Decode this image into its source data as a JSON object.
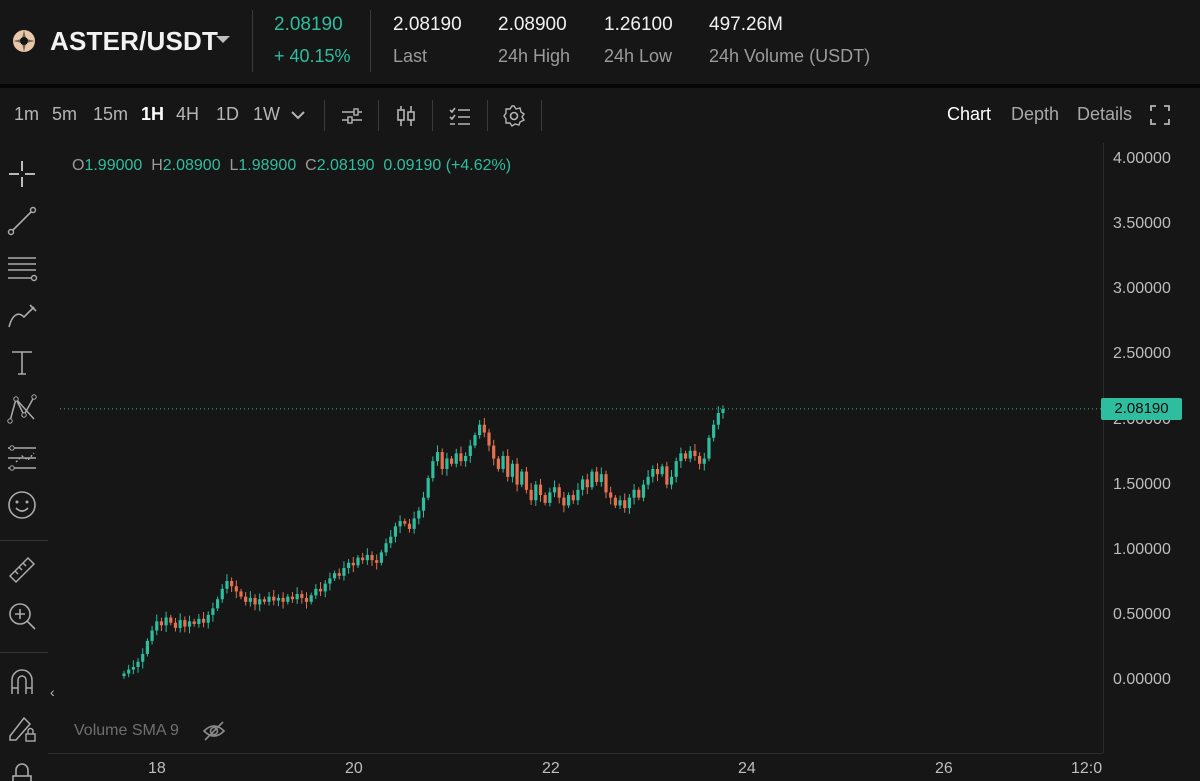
{
  "header": {
    "pair": "ASTER/USDT",
    "last_price": "2.08190",
    "change_pct": "+ 40.15%",
    "stats": [
      {
        "value": "2.08190",
        "label": "Last"
      },
      {
        "value": "2.08900",
        "label": "24h High"
      },
      {
        "value": "1.26100",
        "label": "24h Low"
      },
      {
        "value": "497.26M",
        "label": "24h Volume (USDT)"
      }
    ]
  },
  "toolbar": {
    "timeframes": [
      "1m",
      "5m",
      "15m",
      "1H",
      "4H",
      "1D",
      "1W"
    ],
    "active_timeframe": "1H",
    "views": [
      "Chart",
      "Depth",
      "Details"
    ],
    "active_view": "Chart"
  },
  "left_tools": [
    "crosshair-icon",
    "trendline-icon",
    "horizontal-lines-icon",
    "brush-icon",
    "text-icon",
    "pattern-icon",
    "forecast-icon",
    "emoji-icon",
    "ruler-icon",
    "zoom-in-icon",
    "magnet-icon",
    "lock-draw-icon",
    "lock-icon"
  ],
  "ohlc": {
    "o_label": "O",
    "o": "1.99000",
    "h_label": "H",
    "h": "2.08900",
    "l_label": "L",
    "l": "1.98900",
    "c_label": "C",
    "c": "2.08190",
    "change": "0.09190",
    "change_pct": "(+4.62%)"
  },
  "price_tag": "2.08190",
  "volume_label": "Volume SMA 9",
  "colors": {
    "up": "#2ebd9f",
    "down": "#e5714f",
    "bg": "#161616"
  },
  "chart_data": {
    "type": "candlestick",
    "y_ticks": [
      "4.00000",
      "3.50000",
      "3.00000",
      "2.50000",
      "2.00000",
      "1.50000",
      "1.00000",
      "0.50000",
      "0.00000"
    ],
    "ylim": [
      0,
      4.0
    ],
    "x_ticks": [
      "18",
      "20",
      "22",
      "24",
      "26",
      "12:0"
    ],
    "last_price": 2.0819,
    "close_series": [
      0.05,
      0.08,
      0.1,
      0.14,
      0.2,
      0.3,
      0.38,
      0.45,
      0.42,
      0.48,
      0.44,
      0.4,
      0.46,
      0.41,
      0.45,
      0.43,
      0.47,
      0.44,
      0.5,
      0.55,
      0.62,
      0.7,
      0.76,
      0.72,
      0.68,
      0.64,
      0.6,
      0.63,
      0.58,
      0.62,
      0.6,
      0.64,
      0.61,
      0.63,
      0.6,
      0.64,
      0.62,
      0.66,
      0.63,
      0.6,
      0.65,
      0.7,
      0.68,
      0.74,
      0.78,
      0.82,
      0.8,
      0.86,
      0.9,
      0.88,
      0.94,
      0.92,
      0.96,
      0.92,
      0.9,
      0.98,
      1.05,
      1.1,
      1.18,
      1.22,
      1.2,
      1.16,
      1.24,
      1.3,
      1.4,
      1.55,
      1.68,
      1.75,
      1.62,
      1.7,
      1.66,
      1.74,
      1.68,
      1.72,
      1.8,
      1.88,
      1.96,
      1.9,
      1.8,
      1.7,
      1.62,
      1.72,
      1.56,
      1.66,
      1.5,
      1.6,
      1.46,
      1.38,
      1.5,
      1.42,
      1.36,
      1.44,
      1.48,
      1.4,
      1.34,
      1.42,
      1.38,
      1.46,
      1.54,
      1.48,
      1.6,
      1.52,
      1.58,
      1.44,
      1.4,
      1.34,
      1.38,
      1.32,
      1.4,
      1.46,
      1.4,
      1.5,
      1.56,
      1.62,
      1.58,
      1.64,
      1.5,
      1.56,
      1.68,
      1.74,
      1.7,
      1.76,
      1.72,
      1.66,
      1.7,
      1.86,
      1.96,
      2.05,
      2.08
    ]
  }
}
